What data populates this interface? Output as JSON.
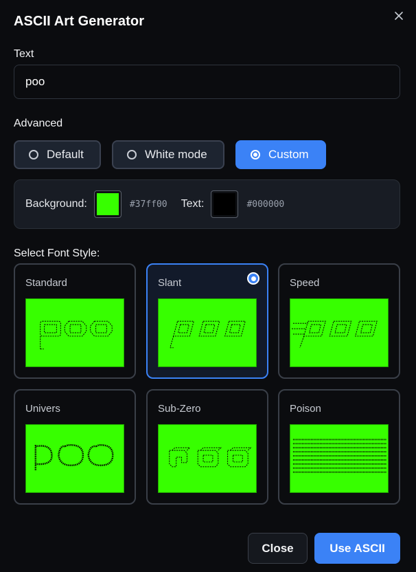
{
  "dialog": {
    "title": "ASCII Art Generator"
  },
  "text_field": {
    "label": "Text",
    "value": "poo"
  },
  "advanced": {
    "label": "Advanced",
    "modes": [
      {
        "label": "Default",
        "selected": false
      },
      {
        "label": "White mode",
        "selected": false
      },
      {
        "label": "Custom",
        "selected": true
      }
    ],
    "background": {
      "label": "Background:",
      "color": "#37ff00",
      "hex": "#37ff00"
    },
    "text_color": {
      "label": "Text:",
      "color": "#000000",
      "hex": "#000000"
    }
  },
  "font_style": {
    "label": "Select Font Style:",
    "fonts": [
      {
        "name": "Standard",
        "selected": false
      },
      {
        "name": "Slant",
        "selected": true
      },
      {
        "name": "Speed",
        "selected": false
      },
      {
        "name": "Univers",
        "selected": false
      },
      {
        "name": "Sub-Zero",
        "selected": false
      },
      {
        "name": "Poison",
        "selected": false
      }
    ]
  },
  "footer": {
    "close_label": "Close",
    "use_label": "Use ASCII"
  },
  "colors": {
    "accent": "#3b82f6",
    "preview_bg": "#37ff00"
  }
}
